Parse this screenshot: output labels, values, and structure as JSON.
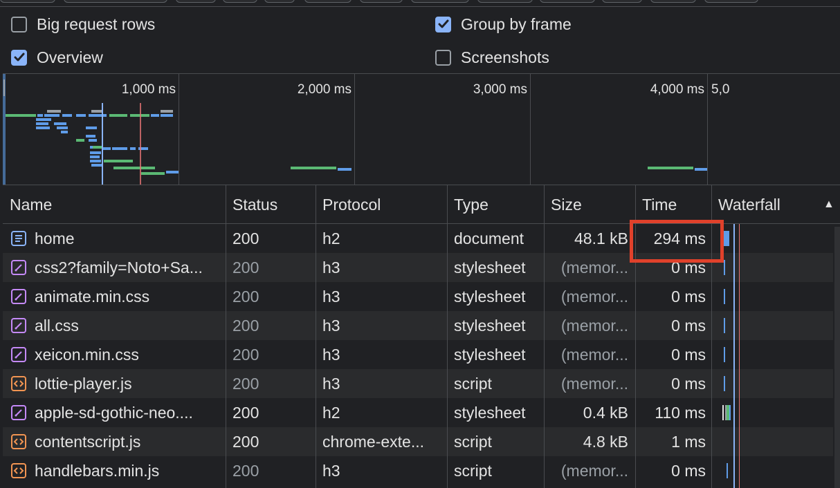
{
  "settings": {
    "big_request_rows": {
      "label": "Big request rows",
      "checked": false
    },
    "group_by_frame": {
      "label": "Group by frame",
      "checked": true
    },
    "overview": {
      "label": "Overview",
      "checked": true
    },
    "screenshots": {
      "label": "Screenshots",
      "checked": false
    }
  },
  "overview": {
    "ticks": [
      "1,000 ms",
      "2,000 ms",
      "3,000 ms",
      "4,000 ms",
      "5,0"
    ]
  },
  "columns": {
    "name": "Name",
    "status": "Status",
    "protocol": "Protocol",
    "type": "Type",
    "size": "Size",
    "time": "Time",
    "waterfall": "Waterfall",
    "sort_indicator": "▲"
  },
  "rows": [
    {
      "icon": "document-icon",
      "name": "home",
      "status": "200",
      "status_muted": false,
      "protocol": "h2",
      "type": "document",
      "size": "48.1 kB",
      "size_muted": false,
      "time": "294 ms"
    },
    {
      "icon": "stylesheet-icon",
      "name": "css2?family=Noto+Sa...",
      "status": "200",
      "status_muted": true,
      "protocol": "h3",
      "type": "stylesheet",
      "size": "(memor...",
      "size_muted": true,
      "time": "0 ms"
    },
    {
      "icon": "stylesheet-icon",
      "name": "animate.min.css",
      "status": "200",
      "status_muted": true,
      "protocol": "h3",
      "type": "stylesheet",
      "size": "(memor...",
      "size_muted": true,
      "time": "0 ms"
    },
    {
      "icon": "stylesheet-icon",
      "name": "all.css",
      "status": "200",
      "status_muted": true,
      "protocol": "h3",
      "type": "stylesheet",
      "size": "(memor...",
      "size_muted": true,
      "time": "0 ms"
    },
    {
      "icon": "stylesheet-icon",
      "name": "xeicon.min.css",
      "status": "200",
      "status_muted": true,
      "protocol": "h3",
      "type": "stylesheet",
      "size": "(memor...",
      "size_muted": true,
      "time": "0 ms"
    },
    {
      "icon": "script-icon",
      "name": "lottie-player.js",
      "status": "200",
      "status_muted": true,
      "protocol": "h3",
      "type": "script",
      "size": "(memor...",
      "size_muted": true,
      "time": "0 ms"
    },
    {
      "icon": "stylesheet-icon",
      "name": "apple-sd-gothic-neo....",
      "status": "200",
      "status_muted": false,
      "protocol": "h2",
      "type": "stylesheet",
      "size": "0.4 kB",
      "size_muted": false,
      "time": "110 ms"
    },
    {
      "icon": "script-icon",
      "name": "contentscript.js",
      "status": "200",
      "status_muted": false,
      "protocol": "chrome-exte...",
      "type": "script",
      "size": "4.8 kB",
      "size_muted": false,
      "time": "1 ms"
    },
    {
      "icon": "script-icon",
      "name": "handlebars.min.js",
      "status": "200",
      "status_muted": true,
      "protocol": "h3",
      "type": "script",
      "size": "(memor...",
      "size_muted": true,
      "time": "0 ms"
    }
  ],
  "colors": {
    "accent": "#8ab4f8",
    "highlight_box": "#e0412b",
    "bar_blue": "#5f9ce8",
    "bar_green": "#5bb974",
    "stylesheet_icon": "#c58af9",
    "script_icon": "#f29552"
  }
}
